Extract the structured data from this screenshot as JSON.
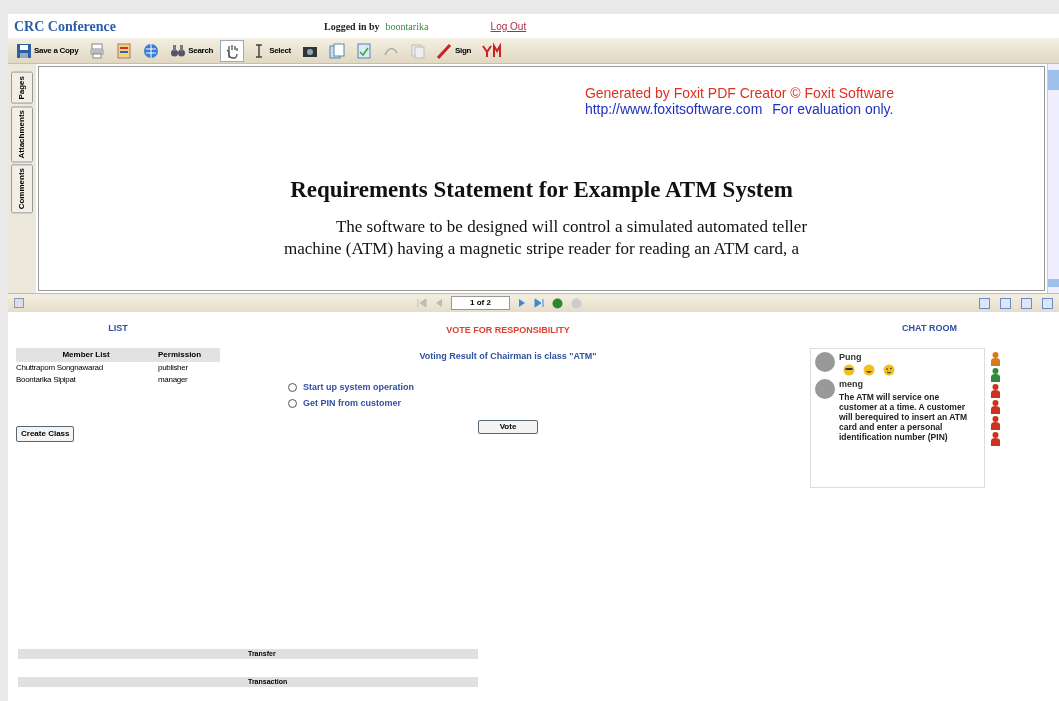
{
  "header": {
    "title": "CRC Conference",
    "logged_in_label": "Logged in by",
    "user": "boontarika",
    "logout": "Log Out"
  },
  "toolbar": [
    {
      "kind": "save",
      "label": "Save a Copy",
      "selected": false
    },
    {
      "kind": "print",
      "selected": false
    },
    {
      "kind": "form",
      "selected": false
    },
    {
      "kind": "web",
      "selected": false
    },
    {
      "kind": "search",
      "label": "Search",
      "selected": false
    },
    {
      "kind": "hand",
      "selected": true
    },
    {
      "kind": "select",
      "label": "Select",
      "selected": false
    },
    {
      "kind": "snapshot",
      "selected": false
    },
    {
      "kind": "page",
      "selected": false
    },
    {
      "kind": "check",
      "selected": false
    },
    {
      "kind": "curve",
      "selected": false
    },
    {
      "kind": "copy",
      "selected": false
    },
    {
      "kind": "sign",
      "label": "Sign",
      "selected": false
    },
    {
      "kind": "messenger",
      "selected": false
    }
  ],
  "side_tabs": [
    {
      "label": "Pages",
      "selected": false
    },
    {
      "label": "Attachments",
      "selected": false
    },
    {
      "label": "Comments",
      "selected": false
    }
  ],
  "document": {
    "notice_line_1": "Generated by Foxit PDF Creator © Foxit Software",
    "notice_link": "http://www.foxitsoftware.com",
    "notice_line_2": "For evaluation only.",
    "heading": "Requirements Statement for Example ATM System",
    "line_1": "The software to be designed will control a simulated automated teller",
    "line_2": "machine (ATM) having a magnetic stripe reader for reading an ATM card, a"
  },
  "pager": {
    "page": "1 of 2"
  },
  "list": {
    "title": "LIST",
    "columns": [
      "Member List",
      "Permission"
    ],
    "rows": [
      [
        "Chuttrapom Songnawarad",
        "publisher"
      ],
      [
        "Boontarika Sipipat",
        "manager"
      ]
    ],
    "create_button": "Create Class"
  },
  "vote": {
    "title": "VOTE FOR RESPONSIBILITY",
    "result": "Voting Result of Chairman is class \"ATM\"",
    "options": [
      {
        "label": "Start up system operation",
        "selected": false
      },
      {
        "label": "Get PIN from customer",
        "selected": false
      }
    ],
    "button": "Vote"
  },
  "chat": {
    "title": "CHAT ROOM",
    "messages": [
      {
        "name": "Pung",
        "emoticons": [
          {
            "kind": "cool"
          },
          {
            "kind": "laugh"
          },
          {
            "kind": "wink"
          }
        ]
      },
      {
        "name": "meng",
        "text": "The ATM will service one customer at a time. A customer will berequired to insert an ATM card and enter a personal identification number (PIN)"
      }
    ],
    "users": [
      {
        "color": "#d97a1c"
      },
      {
        "color": "#2f8a3a"
      },
      {
        "color": "#c8321e"
      },
      {
        "color": "#c8321e"
      },
      {
        "color": "#c8321e"
      },
      {
        "color": "#c8321e"
      }
    ]
  },
  "cards": [
    {
      "label": "Transfer"
    },
    {
      "label": "Transaction"
    }
  ]
}
